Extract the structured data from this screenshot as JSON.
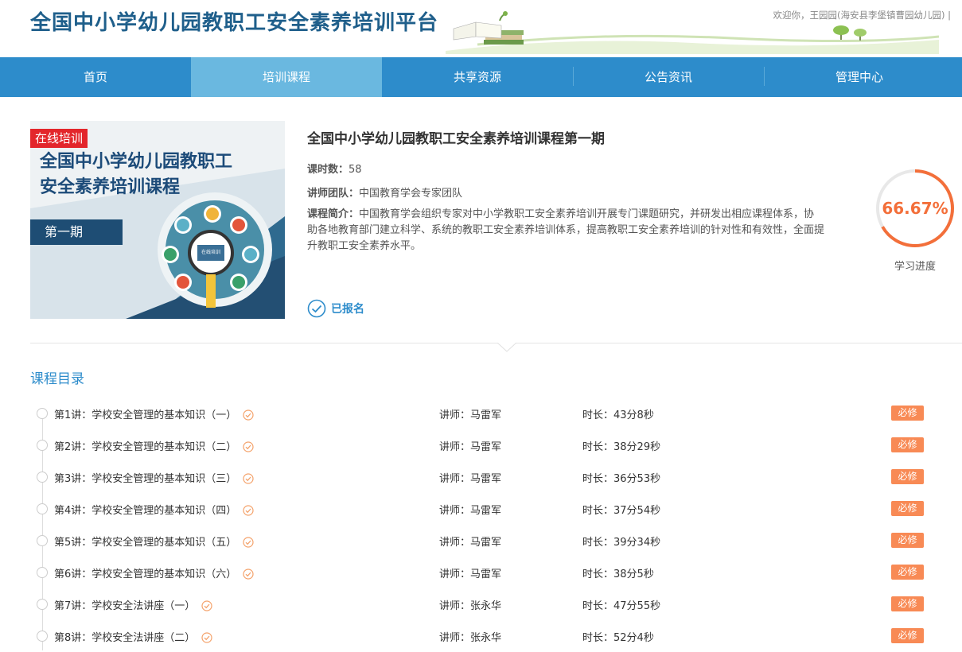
{
  "header": {
    "site_title": "全国中小学幼儿园教职工安全素养培训平台",
    "welcome": "欢迎你，王园园(海安县李堡镇曹园幼儿园)  |"
  },
  "nav": [
    "首页",
    "培训课程",
    "共享资源",
    "公告资讯",
    "管理中心"
  ],
  "nav_active_index": 1,
  "course": {
    "cover": {
      "tag": "在线培训",
      "title_line1": "全国中小学幼儿园教职工",
      "title_line2": "安全素养培训课程",
      "issue": "第一期",
      "screen_text": "在线培训"
    },
    "name": "全国中小学幼儿园教职工安全素养培训课程第一期",
    "hours_label": "课时数：",
    "hours_value": "58",
    "team_label": "讲师团队：",
    "team_value": "中国教育学会专家团队",
    "intro_label": "课程简介：",
    "intro_value": "中国教育学会组织专家对中小学教职工安全素养培训开展专门课题研究，并研发出相应课程体系，协助各地教育部门建立科学、系统的教职工安全素养培训体系，提高教职工安全素养培训的针对性和有效性，全面提升教职工安全素养水平。",
    "enrolled_label": "已报名",
    "progress_text": "66.67%",
    "progress_fraction": 0.6667,
    "progress_label": "学习进度"
  },
  "catalog": {
    "title": "课程目录",
    "lessons": [
      {
        "name": "第1讲：学校安全管理的基本知识（一）",
        "teacher": "讲师：马雷军",
        "duration": "时长：43分8秒",
        "tag": "必修"
      },
      {
        "name": "第2讲：学校安全管理的基本知识（二）",
        "teacher": "讲师：马雷军",
        "duration": "时长：38分29秒",
        "tag": "必修"
      },
      {
        "name": "第3讲：学校安全管理的基本知识（三）",
        "teacher": "讲师：马雷军",
        "duration": "时长：36分53秒",
        "tag": "必修"
      },
      {
        "name": "第4讲：学校安全管理的基本知识（四）",
        "teacher": "讲师：马雷军",
        "duration": "时长：37分54秒",
        "tag": "必修"
      },
      {
        "name": "第5讲：学校安全管理的基本知识（五）",
        "teacher": "讲师：马雷军",
        "duration": "时长：39分34秒",
        "tag": "必修"
      },
      {
        "name": "第6讲：学校安全管理的基本知识（六）",
        "teacher": "讲师：马雷军",
        "duration": "时长：38分5秒",
        "tag": "必修"
      },
      {
        "name": "第7讲：学校安全法讲座（一）",
        "teacher": "讲师：张永华",
        "duration": "时长：47分55秒",
        "tag": "必修"
      },
      {
        "name": "第8讲：学校安全法讲座（二）",
        "teacher": "讲师：张永华",
        "duration": "时长：52分4秒",
        "tag": "必修"
      }
    ]
  },
  "colors": {
    "nav_bg": "#2d8ccb",
    "nav_active": "#6ab8e0",
    "progress": "#f36f3a",
    "required_tag": "#f88a55",
    "cover_tag": "#e3262b"
  }
}
